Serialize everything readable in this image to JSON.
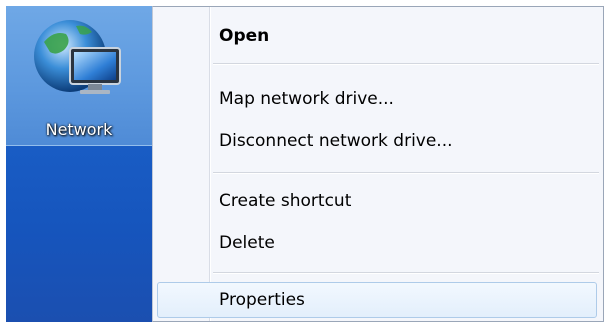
{
  "desktop": {
    "icon": {
      "name": "network-icon",
      "label": "Network"
    }
  },
  "context_menu": {
    "items": [
      {
        "label": "Open",
        "bold": true
      },
      {
        "label": "Map network drive...",
        "bold": false
      },
      {
        "label": "Disconnect network drive...",
        "bold": false
      },
      {
        "label": "Create shortcut",
        "bold": false
      },
      {
        "label": "Delete",
        "bold": false
      },
      {
        "label": "Properties",
        "bold": false,
        "highlighted": true
      }
    ]
  },
  "colors": {
    "desktop_blue": "#1a5fc7",
    "highlight_border": "#aecbe9"
  }
}
